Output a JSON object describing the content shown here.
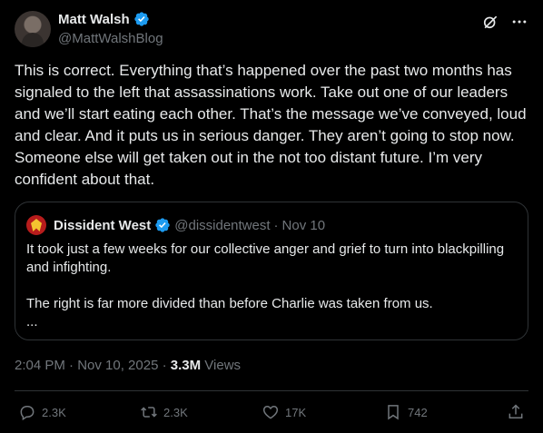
{
  "author": {
    "name": "Matt Walsh",
    "handle": "@MattWalshBlog"
  },
  "post": {
    "text": "This is correct. Everything that’s happened over the past two months has signaled to the left that assassinations work. Take out one of our leaders and we’ll start eating each other. That’s the message we’ve conveyed, loud and clear. And it puts us in serious danger. They aren’t going to stop now. Someone else will get taken out in the not too distant future. I’m very confident about that."
  },
  "quote": {
    "name": "Dissident West",
    "handle": "@dissidentwest",
    "separator": "·",
    "date": "Nov 10",
    "line1": "It took just a few weeks for our collective anger and grief to turn into blackpilling and infighting.",
    "line2": "The right is far more divided than before Charlie was taken from us.",
    "ellipsis": "..."
  },
  "meta": {
    "time": "2:04 PM · Nov 10, 2025 · ",
    "views_count": "3.3M",
    "views_label": " Views"
  },
  "actions": {
    "replies": "2.3K",
    "reposts": "2.3K",
    "likes": "17K",
    "bookmarks": "742"
  },
  "colors": {
    "background": "#000000",
    "text": "#e7e9ea",
    "muted": "#71767b",
    "verified": "#1d9bf0",
    "border": "#2f3336"
  },
  "icons": [
    "verified-badge-icon",
    "grok-icon",
    "more-icon",
    "reply-icon",
    "repost-icon",
    "like-icon",
    "bookmark-icon",
    "share-icon"
  ]
}
